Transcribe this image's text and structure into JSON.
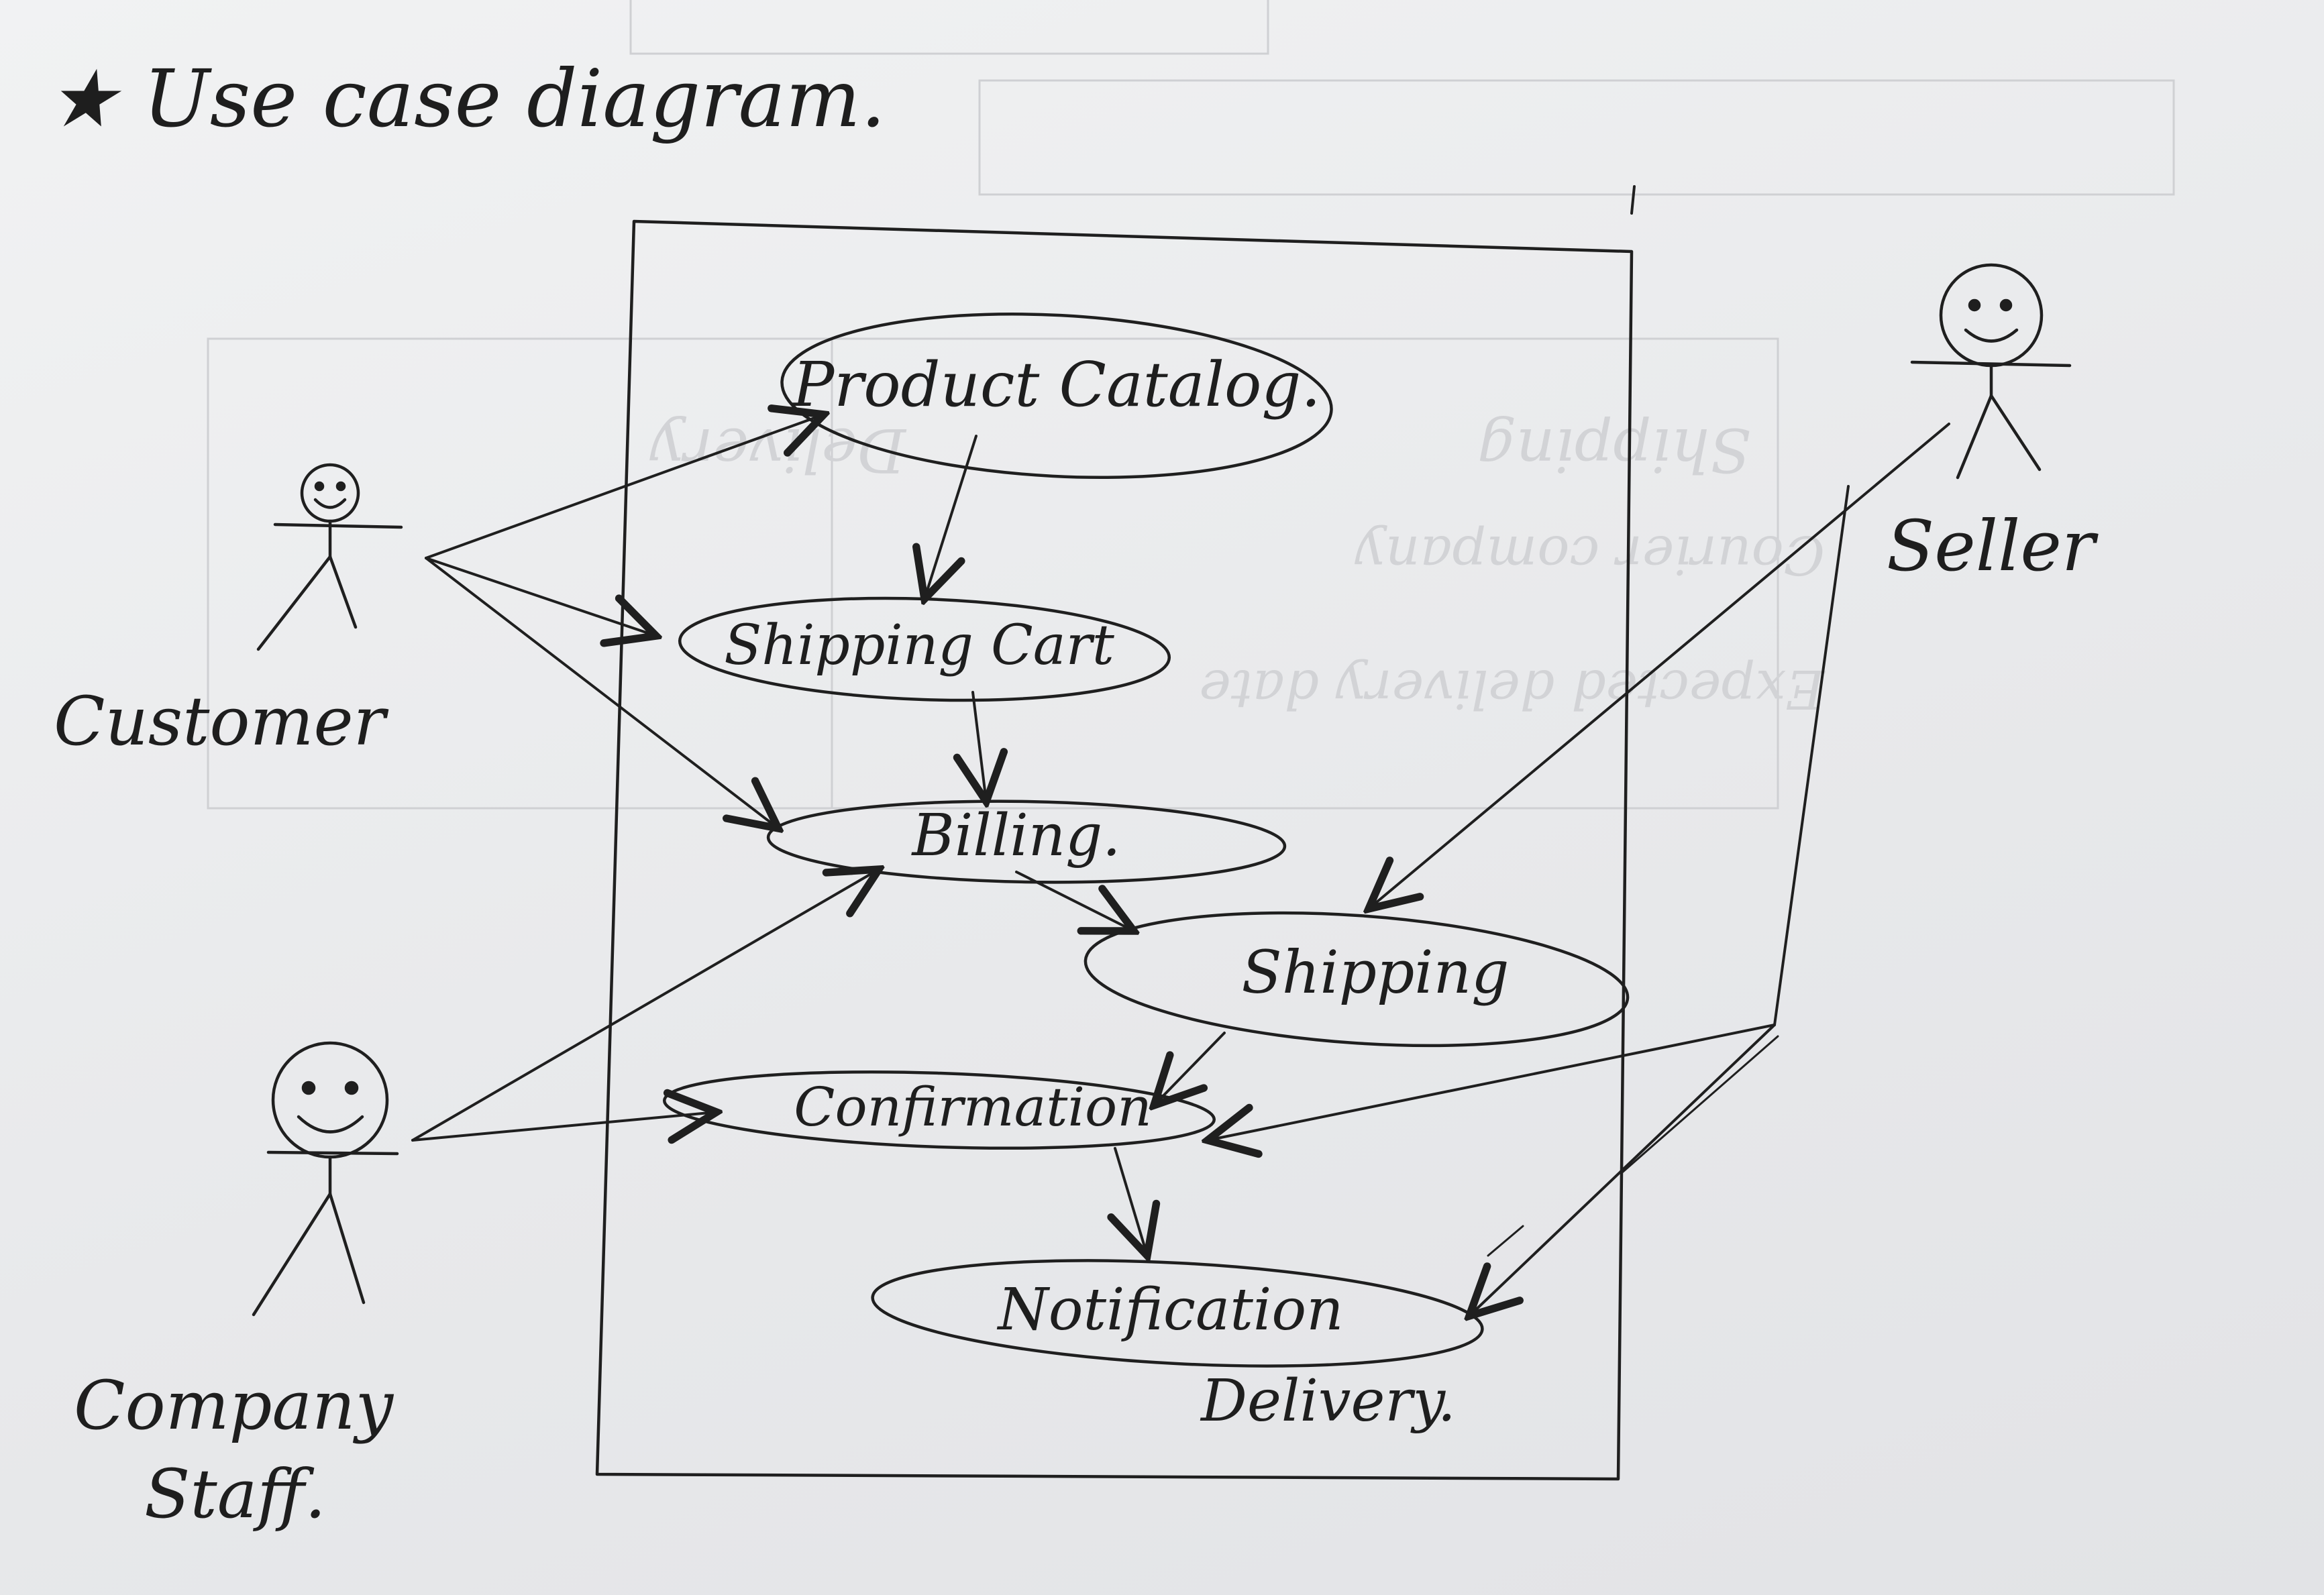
{
  "title": "★ Use case diagram.",
  "actors": {
    "customer": "Customer",
    "staff_line1": "Company",
    "staff_line2": "Staff.",
    "seller": "Seller"
  },
  "use_cases": {
    "product_catalog": "Product Catalog.",
    "shopping_cart": "Shipping Cart",
    "billing": "Billing.",
    "shipping": "Shipping",
    "confirmation": "Confirmation",
    "notification": "Notification",
    "delivery": "Delivery."
  },
  "colors": {
    "ink": "#1f1f1f",
    "paper": "#eceded"
  }
}
